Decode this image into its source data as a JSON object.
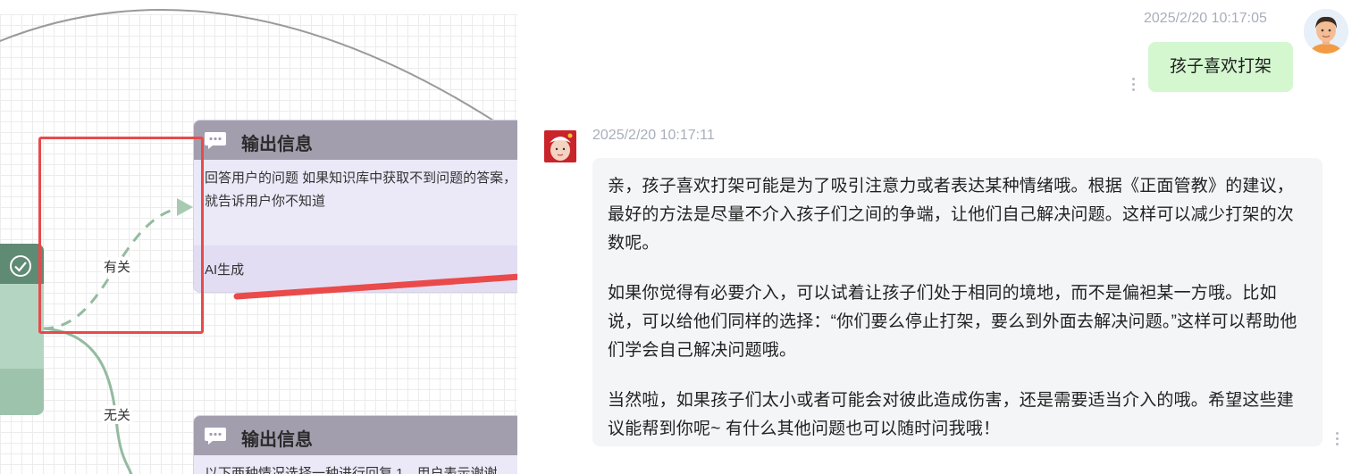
{
  "canvas": {
    "nodes": [
      {
        "title": "输出信息",
        "body": "回答用户的问题 如果知识库中获取不到问题的答案，就告诉用户你不知道",
        "footer": "AI生成"
      },
      {
        "title": "输出信息",
        "body": "以下两种情况选择一种进行回复 1、用户表示谢谢"
      }
    ],
    "edge_labels": [
      "有关",
      "无关"
    ]
  },
  "chat": {
    "messages": [
      {
        "role": "user",
        "timestamp": "2025/2/20 10:17:05",
        "text": "孩子喜欢打架"
      },
      {
        "role": "assistant",
        "timestamp": "2025/2/20 10:17:11",
        "paragraphs": [
          "亲，孩子喜欢打架可能是为了吸引注意力或者表达某种情绪哦。根据《正面管教》的建议，最好的方法是尽量不介入孩子们之间的争端，让他们自己解决问题。这样可以减少打架的次数呢。",
          "如果你觉得有必要介入，可以试着让孩子们处于相同的境地，而不是偏袒某一方哦。比如说，可以给他们同样的选择：“你们要么停止打架，要么到外面去解决问题。”这样可以帮助他们学会自己解决问题哦。",
          "当然啦，如果孩子们太小或者可能会对彼此造成伤害，还是需要适当介入的哦。希望这些建议能帮到你呢~ 有什么其他问题也可以随时问我哦！"
        ]
      }
    ]
  },
  "colors": {
    "highlight": "#e84a4a",
    "user_bubble": "#d4f7d0",
    "bot_bubble": "#f4f5f7",
    "node_header": "#a39eae",
    "node_body": "#ebe8f8",
    "green_node": "#5f8a73"
  },
  "icons": [
    "check-circle-icon",
    "chat-bubble-icon",
    "kebab-menu-icon",
    "user-avatar",
    "bot-avatar"
  ]
}
